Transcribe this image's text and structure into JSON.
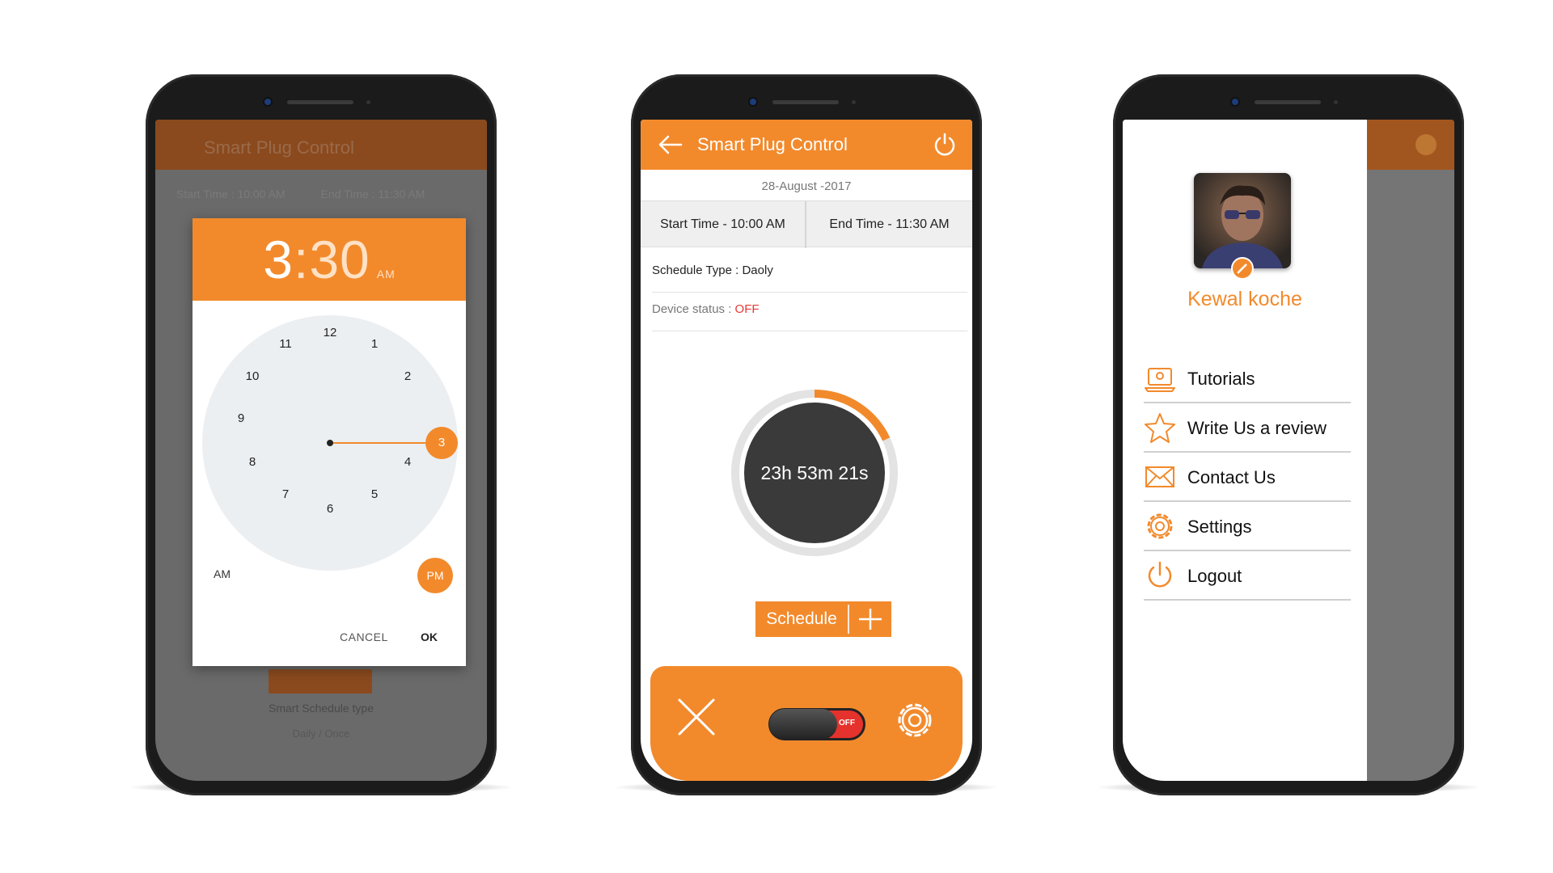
{
  "colors": {
    "accent": "#f28a2c",
    "off_red": "#e53935",
    "dark": "#3a3a3a"
  },
  "phone1": {
    "background_title": "Smart Plug Control",
    "background_row": [
      "Start Time : 10:00 AM",
      "End Time : 11:30 AM"
    ],
    "background_line1": "Smart Schedule type",
    "background_line2": "Daily  /  Once",
    "time_picker": {
      "hour": "3",
      "separator": ":",
      "minute": "30",
      "period": "AM",
      "dial_numbers": [
        "12",
        "1",
        "2",
        "3",
        "4",
        "5",
        "6",
        "7",
        "8",
        "9",
        "10",
        "11"
      ],
      "selected": "3",
      "am_label": "AM",
      "pm_label": "PM",
      "cancel_label": "CANCEL",
      "ok_label": "OK"
    }
  },
  "phone2": {
    "title": "Smart Plug Control",
    "date": "28-August -2017",
    "start_time": "Start Time - 10:00 AM",
    "end_time": "End Time - 11:30 AM",
    "schedule_type": "Schedule Type : Daoly",
    "device_status_label": "Device status : ",
    "device_status_value": "OFF",
    "countdown": "23h 53m 21s",
    "countdown_progress": 0.18,
    "schedule_button": "Schedule",
    "toggle_label": "OFF",
    "icons": {
      "back": "arrow-left-icon",
      "power": "power-icon",
      "add": "plus-icon",
      "close": "close-icon",
      "settings": "gear-icon"
    }
  },
  "phone3": {
    "user_name": "Kewal koche",
    "menu": [
      {
        "label": "Tutorials",
        "icon": "laptop-icon"
      },
      {
        "label": "Write Us a review",
        "icon": "star-icon"
      },
      {
        "label": "Contact Us",
        "icon": "mail-icon"
      },
      {
        "label": "Settings",
        "icon": "gear-icon"
      },
      {
        "label": "Logout",
        "icon": "power-icon"
      }
    ]
  }
}
